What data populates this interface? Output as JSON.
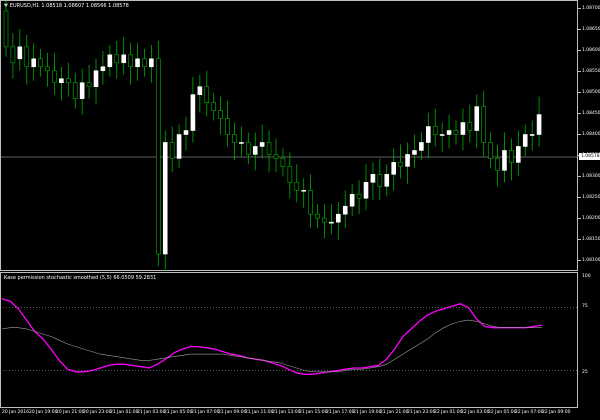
{
  "symbol": {
    "name": "EURUSD,H1",
    "ohlc": "1.08518 1.08607 1.08566 1.08578"
  },
  "indicator": {
    "title": "Kase permission stochastic smoothed (5,5) 66.0509 59.2831",
    "levels": {
      "top": "100",
      "upper": "75",
      "lower": "25"
    }
  },
  "price_axis": {
    "labels": [
      "1.08700",
      "1.08650",
      "1.08600",
      "1.08550",
      "1.08500",
      "1.08450",
      "1.08400",
      "1.08350",
      "1.08300",
      "1.08250",
      "1.08200",
      "1.08150",
      "1.08100"
    ],
    "current": "1.08578"
  },
  "time_axis": {
    "labels": [
      "20 Jan 2016",
      "20 Jan 19:00",
      "20 Jan 21:00",
      "20 Jan 23:00",
      "21 Jan 01:00",
      "21 Jan 03:00",
      "21 Jan 05:00",
      "21 Jan 07:00",
      "21 Jan 09:00",
      "21 Jan 11:00",
      "21 Jan 13:00",
      "21 Jan 15:00",
      "21 Jan 17:00",
      "21 Jan 19:00",
      "21 Jan 21:00",
      "21 Jan 23:00",
      "22 Jan 01:00",
      "22 Jan 03:00",
      "22 Jan 05:00",
      "22 Jan 07:00",
      "22 Jan 09:00"
    ]
  },
  "colors": {
    "bull_body": "#ffffff",
    "bear_body": "#000000",
    "wick": "#00b000",
    "k_line": "#ff00ff",
    "d_line": "#9e9e9e",
    "grid": "#bdbdbd"
  },
  "chart_data": [
    {
      "type": "candlestick",
      "title": "EURUSD,H1",
      "ylim": [
        1.0808,
        1.0872
      ],
      "opens": [
        1.0871,
        1.0862,
        1.0859,
        1.0862,
        1.0857,
        1.0859,
        1.0857,
        1.0856,
        1.0853,
        1.0854,
        1.0853,
        1.0849,
        1.0853,
        1.0852,
        1.0856,
        1.0857,
        1.086,
        1.0858,
        1.086,
        1.0857,
        1.0859,
        1.0857,
        1.0859,
        1.081,
        1.0838,
        1.0834,
        1.084,
        1.0841,
        1.085,
        1.0852,
        1.0848,
        1.0846,
        1.0844,
        1.084,
        1.0838,
        1.0838,
        1.0835,
        1.0837,
        1.0838,
        1.0835,
        1.0834,
        1.0832,
        1.0828,
        1.0826,
        1.0826,
        1.082,
        1.0819,
        1.0818,
        1.0818,
        1.082,
        1.0822,
        1.0825,
        1.0824,
        1.0828,
        1.083,
        1.0827,
        1.083,
        1.0833,
        1.0832,
        1.0835,
        1.0836,
        1.0838,
        1.0842,
        1.084,
        1.084,
        1.0841,
        1.084,
        1.0843,
        1.0841,
        1.0847,
        1.0838,
        1.0834,
        1.0831,
        1.0836,
        1.0833,
        1.0837,
        1.084,
        1.084
      ],
      "closes": [
        1.0862,
        1.0858,
        1.0862,
        1.0857,
        1.0859,
        1.0857,
        1.0856,
        1.0853,
        1.0854,
        1.0853,
        1.0849,
        1.0853,
        1.0852,
        1.0856,
        1.0857,
        1.086,
        1.0858,
        1.086,
        1.0857,
        1.0859,
        1.0857,
        1.0859,
        1.081,
        1.0838,
        1.0834,
        1.084,
        1.0841,
        1.085,
        1.0852,
        1.0848,
        1.0846,
        1.0844,
        1.084,
        1.0838,
        1.0838,
        1.0835,
        1.0837,
        1.0838,
        1.0835,
        1.0834,
        1.0832,
        1.0828,
        1.0826,
        1.0826,
        1.082,
        1.0819,
        1.0818,
        1.0818,
        1.082,
        1.0822,
        1.0825,
        1.0824,
        1.0828,
        1.083,
        1.0827,
        1.083,
        1.0833,
        1.0832,
        1.0835,
        1.0836,
        1.0838,
        1.0842,
        1.084,
        1.084,
        1.0841,
        1.084,
        1.0843,
        1.0841,
        1.0847,
        1.0838,
        1.0834,
        1.0831,
        1.0836,
        1.0833,
        1.0837,
        1.084,
        1.084,
        1.0845
      ]
    },
    {
      "type": "line",
      "title": "Kase permission stochastic smoothed (5,5)",
      "ylim": [
        0,
        100
      ],
      "series": [
        {
          "name": "K",
          "values": [
            82,
            80,
            74,
            65,
            56,
            50,
            42,
            33,
            26,
            24,
            24,
            25,
            27,
            29,
            30,
            30,
            29,
            28,
            27,
            30,
            34,
            39,
            42,
            44,
            44,
            43,
            42,
            40,
            38,
            37,
            35,
            34,
            33,
            31,
            29,
            26,
            23,
            22,
            22,
            23,
            24,
            25,
            26,
            27,
            27,
            28,
            29,
            34,
            42,
            52,
            58,
            64,
            69,
            72,
            74,
            76,
            78,
            75,
            66,
            60,
            59,
            59,
            59,
            59,
            59,
            60,
            61
          ]
        },
        {
          "name": "D",
          "values": [
            58,
            59,
            59,
            58,
            56,
            54,
            52,
            49,
            46,
            44,
            42,
            40,
            38,
            37,
            36,
            35,
            34,
            33,
            33,
            34,
            35,
            36,
            37,
            38,
            38,
            38,
            38,
            38,
            37,
            36,
            35,
            34,
            33,
            32,
            31,
            29,
            27,
            25,
            24,
            24,
            24,
            24,
            25,
            26,
            26,
            27,
            28,
            30,
            34,
            38,
            42,
            46,
            50,
            55,
            59,
            62,
            64,
            65,
            64,
            62,
            60,
            59,
            59,
            59,
            59,
            59,
            59
          ]
        }
      ]
    }
  ]
}
